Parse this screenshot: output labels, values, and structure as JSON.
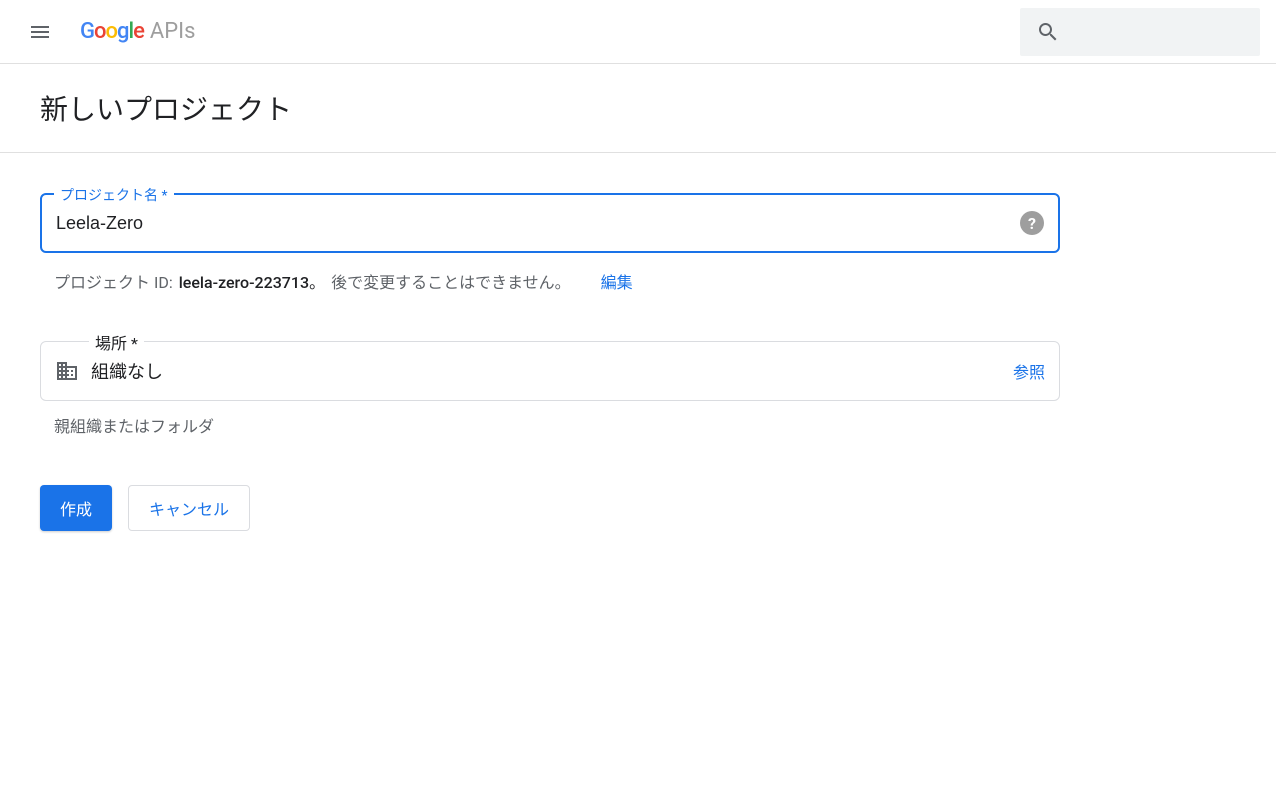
{
  "header": {
    "logo_brand": "Google",
    "logo_product": "APIs"
  },
  "page": {
    "title": "新しいプロジェクト"
  },
  "form": {
    "project_name": {
      "label": "プロジェクト名 *",
      "value": "Leela-Zero"
    },
    "project_id": {
      "prefix": "プロジェクト ID: ",
      "value": "leela-zero-223713。",
      "warning": "後で変更することはできません。",
      "edit_label": "編集"
    },
    "location": {
      "label": "場所 *",
      "value": "組織なし",
      "browse_label": "参照",
      "hint": "親組織またはフォルダ"
    },
    "buttons": {
      "create": "作成",
      "cancel": "キャンセル"
    }
  }
}
